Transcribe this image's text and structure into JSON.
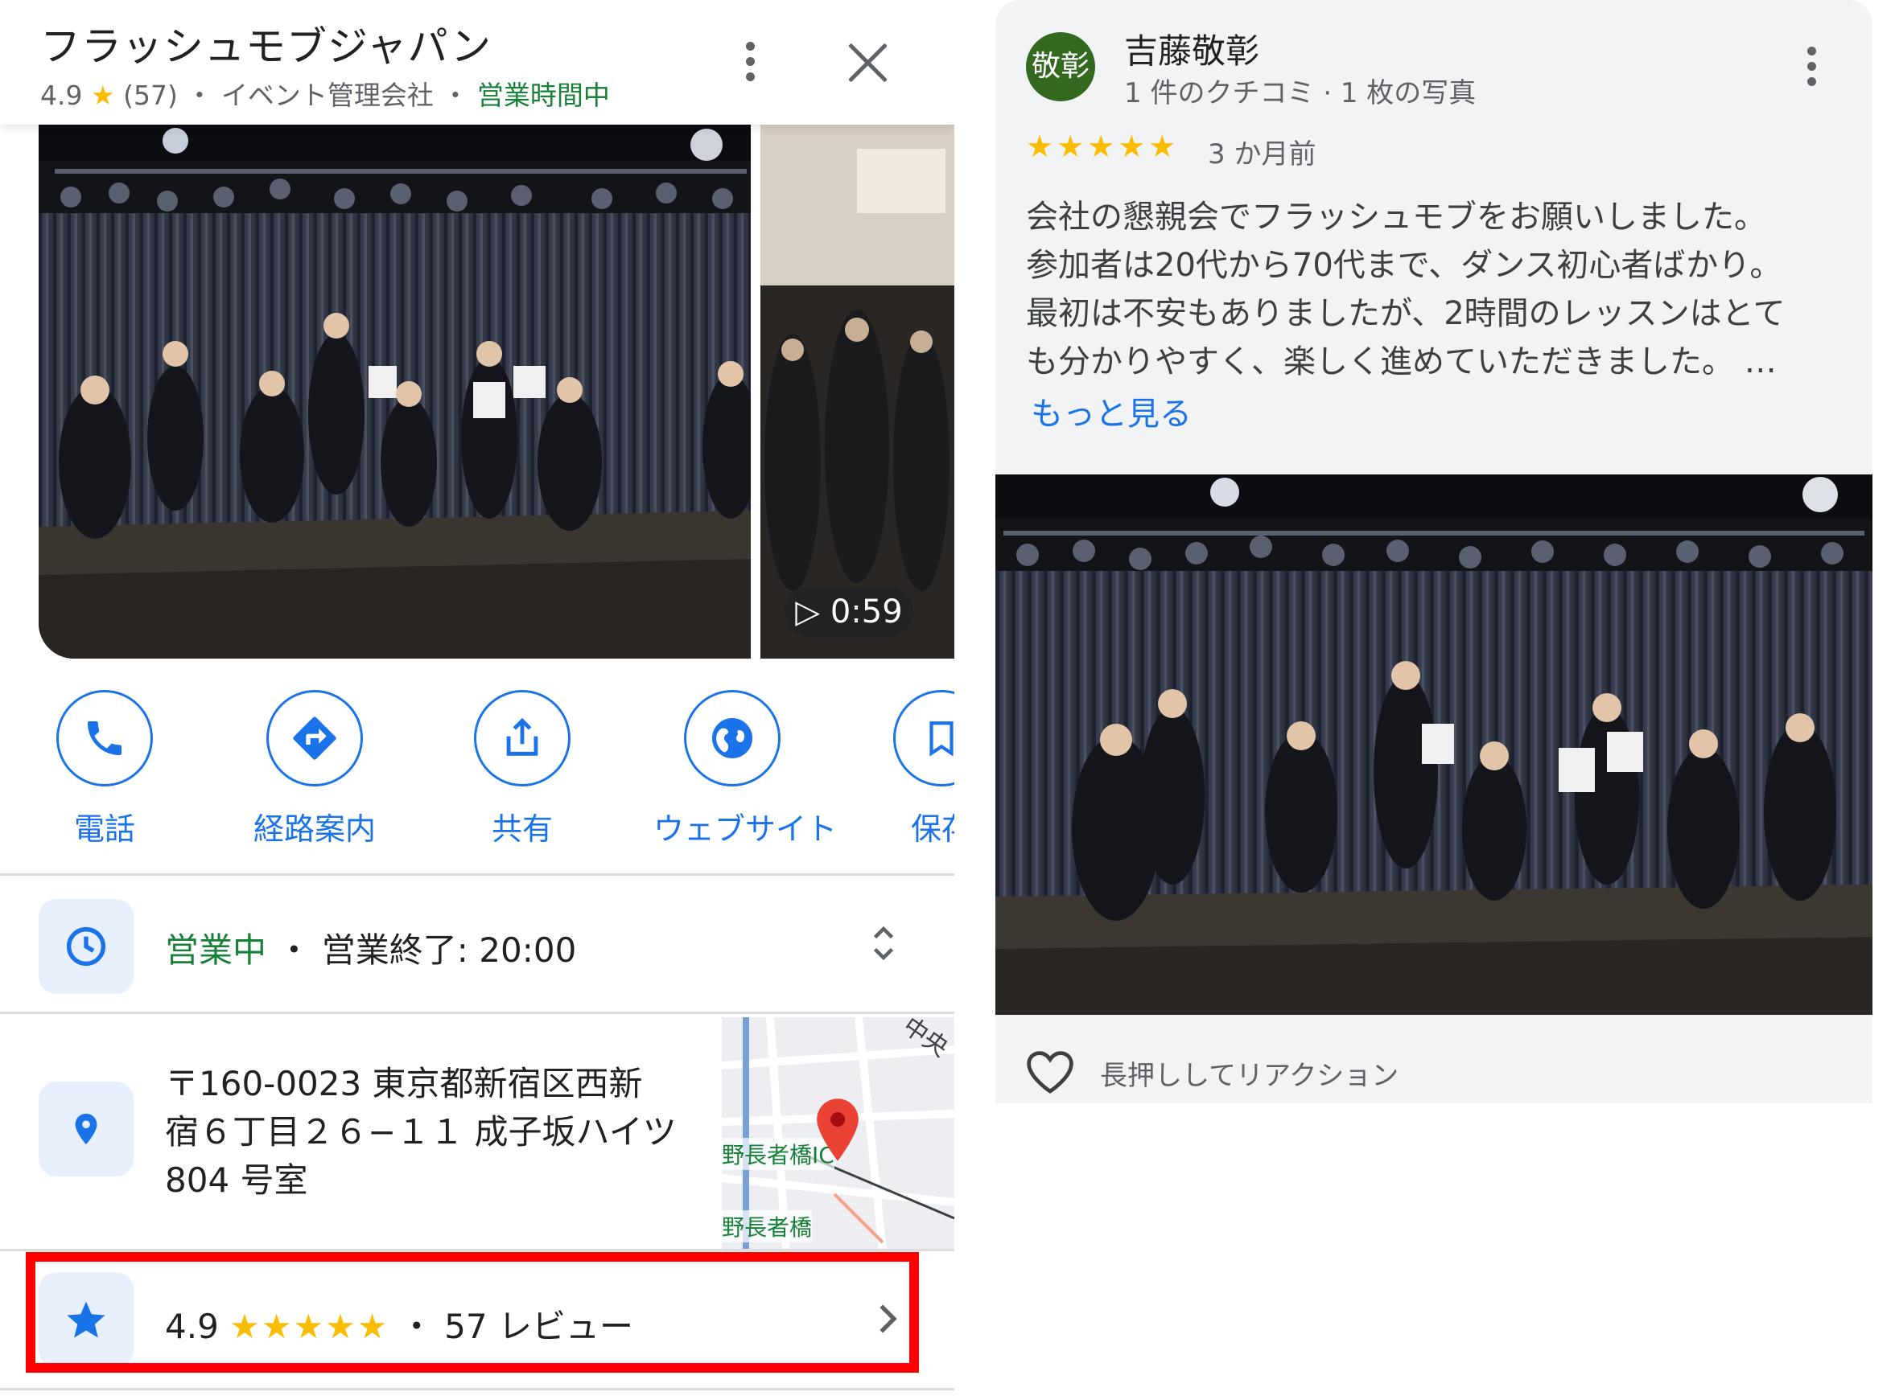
{
  "place": {
    "name": "フラッシュモブジャパン",
    "rating": "4.9",
    "star_glyph": "★",
    "review_count_paren": "(57)",
    "sep": "・",
    "category": "イベント管理会社",
    "status": "営業時間中"
  },
  "video": {
    "duration": "0:59"
  },
  "actions": [
    {
      "label": "電話",
      "icon": "phone-icon"
    },
    {
      "label": "経路案内",
      "icon": "directions-icon"
    },
    {
      "label": "共有",
      "icon": "share-icon"
    },
    {
      "label": "ウェブサイト",
      "icon": "globe-icon"
    },
    {
      "label": "保存",
      "icon": "bookmark-icon"
    }
  ],
  "hours": {
    "open_label": "営業中",
    "dot": "・",
    "close_text": "営業終了: 20:00"
  },
  "address": {
    "lines": [
      "〒160-0023 東京都新宿区西新",
      "宿６丁目２６−１１ 成子坂ハイツ",
      "804 号室"
    ]
  },
  "map": {
    "labels": [
      "中央",
      "野長者橋IC",
      "野長者橋"
    ]
  },
  "ratings_summary": {
    "rating": "4.9",
    "stars": "★★★★★",
    "dot": "・",
    "count_text": "57 レビュー"
  },
  "review": {
    "avatar_text": "敬彰",
    "author": "吉藤敬彰",
    "meta": "1 件のクチコミ · 1 枚の写真",
    "stars": "★★★★★",
    "date": "3 か月前",
    "body_lines": [
      "会社の懇親会でフラッシュモブをお願いしました。",
      "参加者は20代から70代まで、ダンス初心者ばかり。",
      "最初は不安もありましたが、2時間のレッスンはとて",
      "も分かりやすく、楽しく進めていただきました。 …"
    ],
    "more_link": "もっと見る",
    "react_hint": "長押ししてリアクション"
  },
  "colors": {
    "accent_blue": "#1a73e8",
    "open_green": "#188038",
    "star_yellow": "#fbbc04",
    "highlight_red": "#ff0000",
    "avatar_green": "#33691e"
  }
}
